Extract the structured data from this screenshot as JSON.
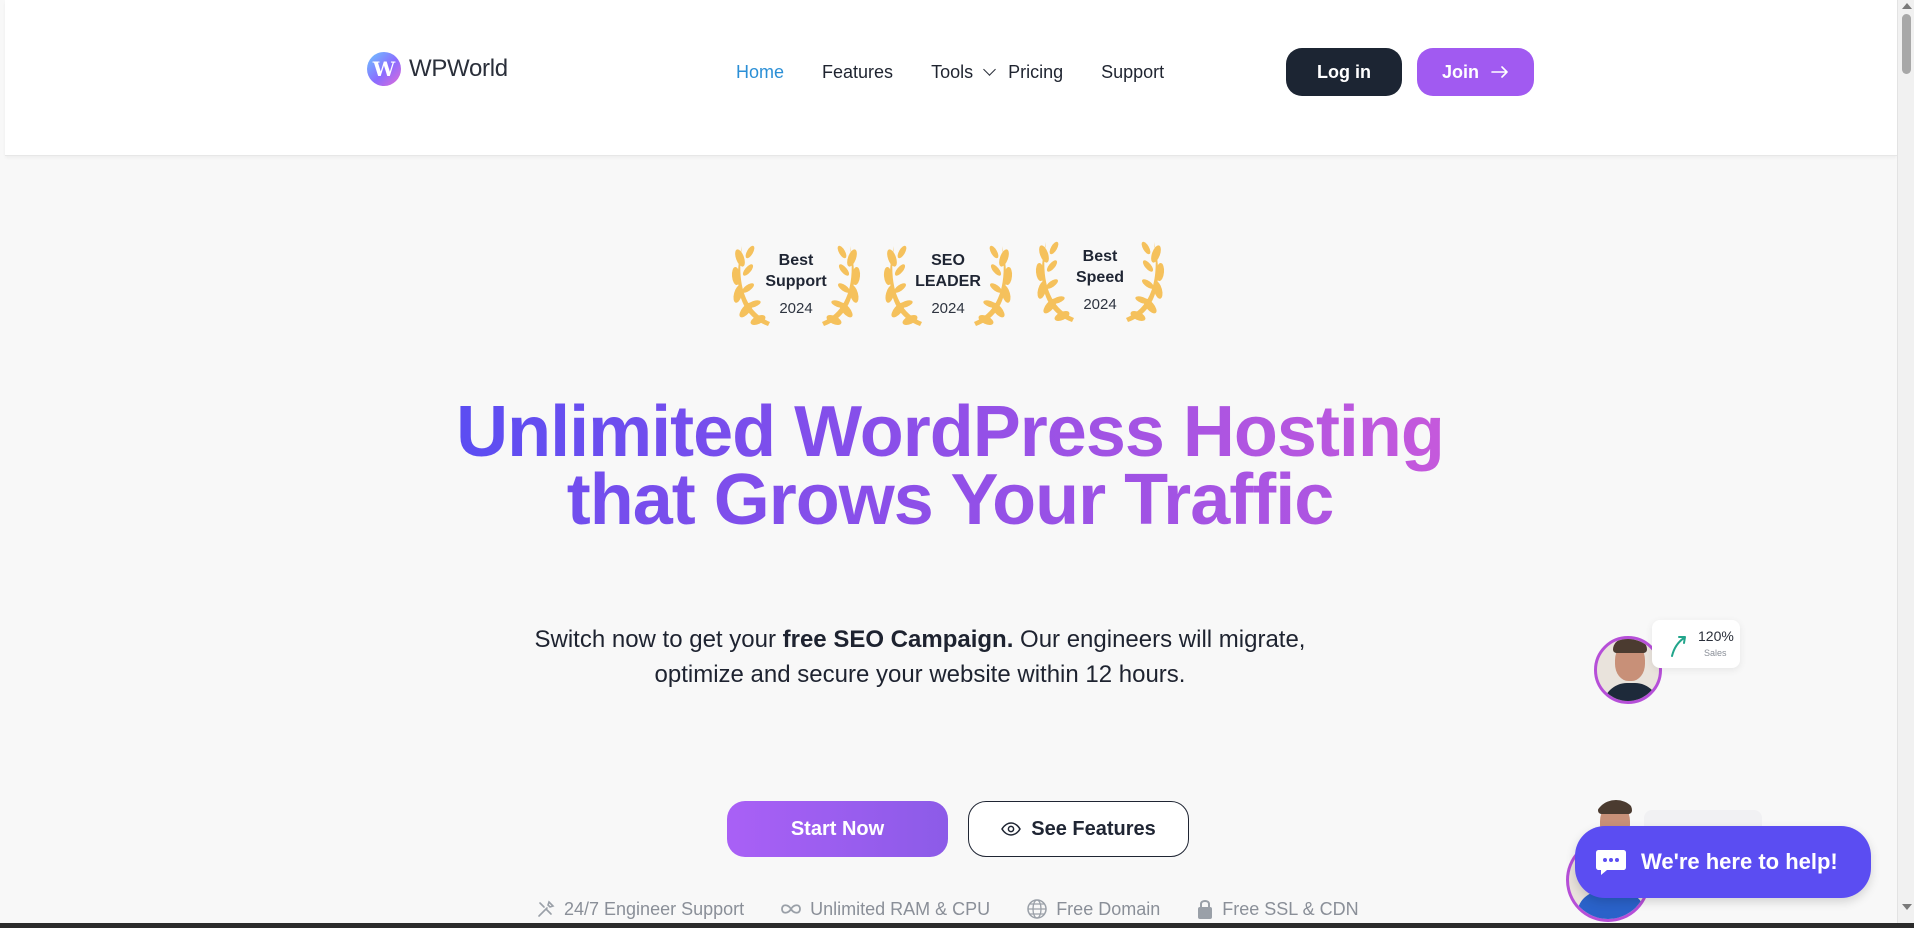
{
  "header": {
    "brand": "WPWorld",
    "logo_letter": "W",
    "nav": [
      {
        "label": "Home",
        "active": true
      },
      {
        "label": "Features",
        "active": false
      },
      {
        "label": "Tools",
        "active": false,
        "has_dropdown": true
      },
      {
        "label": "Pricing",
        "active": false
      },
      {
        "label": "Support",
        "active": false
      }
    ],
    "login_label": "Log in",
    "join_label": "Join"
  },
  "awards": [
    {
      "title_line1": "Best",
      "title_line2": "Support",
      "year": "2024"
    },
    {
      "title_line1": "SEO",
      "title_line2": "LEADER",
      "year": "2024"
    },
    {
      "title_line1": "Best",
      "title_line2": "Speed",
      "year": "2024"
    }
  ],
  "hero": {
    "headline_line1": "Unlimited WordPress Hosting",
    "headline_line2": "that Grows Your Traffic",
    "sub_prefix": "Switch now to get your ",
    "sub_bold": "free SEO Campaign.",
    "sub_suffix": " Our engineers will migrate, optimize and secure your website within 12 hours.",
    "start_label": "Start Now",
    "features_label": "See Features"
  },
  "feature_badges": [
    {
      "icon": "tools-icon",
      "label": "24/7 Engineer Support"
    },
    {
      "icon": "infinity-icon",
      "label": "Unlimited RAM & CPU"
    },
    {
      "icon": "globe-icon",
      "label": "Free Domain"
    },
    {
      "icon": "lock-icon",
      "label": "Free SSL & CDN"
    }
  ],
  "stat_card": {
    "value": "120%",
    "label": "Sales"
  },
  "chat": {
    "label": "We're here to help!"
  },
  "colors": {
    "accent_purple": "#a15af1",
    "dark": "#1c2533",
    "chat_blue": "#5b4df2",
    "nav_active": "#2b8fd6"
  }
}
